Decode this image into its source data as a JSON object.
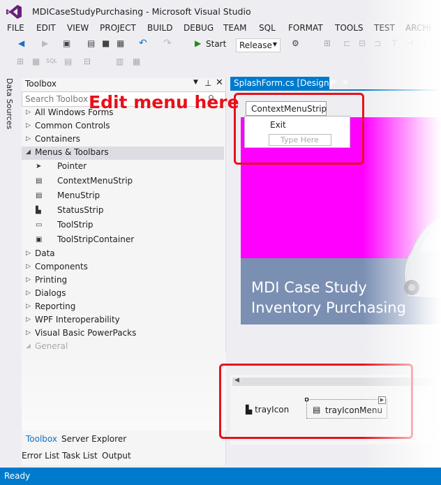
{
  "window": {
    "title": "MDICaseStudyPurchasing - Microsoft Visual Studio"
  },
  "menu": [
    "FILE",
    "EDIT",
    "VIEW",
    "PROJECT",
    "BUILD",
    "DEBUG",
    "TEAM",
    "SQL",
    "FORMAT",
    "TOOLS",
    "TEST",
    "ARCHI"
  ],
  "toolbar": {
    "start_label": "Start",
    "configuration": "Release"
  },
  "side_panel": {
    "label": "Data Sources"
  },
  "toolbox": {
    "title": "Toolbox",
    "search_placeholder": "Search Toolbox",
    "groups": [
      "All Windows Forms",
      "Common Controls",
      "Containers",
      "Menus & Toolbars"
    ],
    "menus_items": [
      "Pointer",
      "ContextMenuStrip",
      "MenuStrip",
      "StatusStrip",
      "ToolStrip",
      "ToolStripContainer"
    ],
    "more_groups": [
      "Data",
      "Components",
      "Printing",
      "Dialogs",
      "Reporting",
      "WPF Interoperability",
      "Visual Basic PowerPacks",
      "General"
    ]
  },
  "bottom_tabs": {
    "toolbox": "Toolbox",
    "server_explorer": "Server Explorer"
  },
  "bottom_tabs2": {
    "error_list": "Error List",
    "task_list": "Task List",
    "output": "Output"
  },
  "document": {
    "tab": "SplashForm.cs [Design]*"
  },
  "designer": {
    "context_menu_strip": "ContextMenuStrip",
    "menu_item": "Exit",
    "type_here": "Type Here",
    "splash_line1": "MDI Case Study",
    "splash_line2": "Inventory Purchasing"
  },
  "tray": {
    "item1": "trayIcon",
    "item2": "trayIconMenu"
  },
  "annotation": "Edit menu here",
  "status": "Ready",
  "colors": {
    "accent": "#007acc",
    "annotation": "#e8101a",
    "splash_bg": "#ff00ff",
    "splash_band": "#7b8fb3"
  }
}
